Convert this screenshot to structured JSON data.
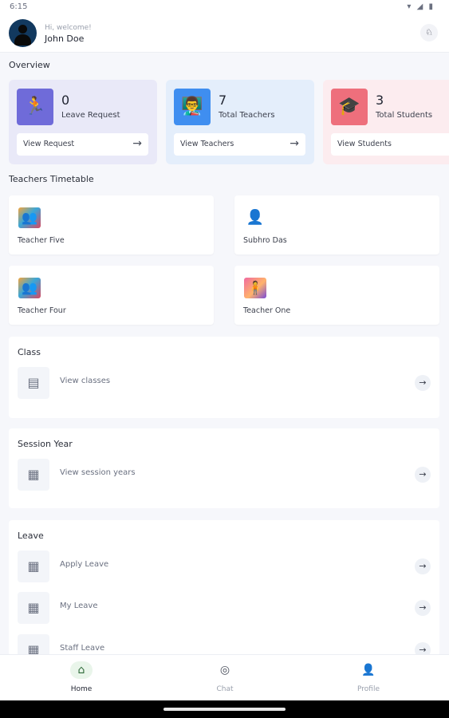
{
  "status_bar": {
    "time": "6:15"
  },
  "header": {
    "greeting": "Hi, welcome!",
    "user_name": "John Doe"
  },
  "overview": {
    "title": "Overview",
    "cards": [
      {
        "count": "0",
        "label": "Leave Request",
        "button": "View Request",
        "accent": "#6f6bd9",
        "bg": "#e9e9f8",
        "icon": "running-person-icon"
      },
      {
        "count": "7",
        "label": "Total Teachers",
        "button": "View Teachers",
        "accent": "#3f8ef0",
        "bg": "#e4eefb",
        "icon": "teacher-podium-icon"
      },
      {
        "count": "3",
        "label": "Total Students",
        "button": "View Students",
        "accent": "#ee6f7c",
        "bg": "#fcecef",
        "icon": "graduation-cap-icon"
      }
    ]
  },
  "timetable": {
    "title": "Teachers Timetable",
    "teachers": [
      {
        "name": "Teacher Five"
      },
      {
        "name": "Subhro Das"
      },
      {
        "name": "Teacher Four"
      },
      {
        "name": "Teacher One"
      }
    ]
  },
  "class_section": {
    "title": "Class",
    "items": [
      {
        "label": "View classes"
      }
    ]
  },
  "session_section": {
    "title": "Session Year",
    "items": [
      {
        "label": "View session years"
      }
    ]
  },
  "leave_section": {
    "title": "Leave",
    "items": [
      {
        "label": "Apply Leave"
      },
      {
        "label": "My Leave"
      },
      {
        "label": "Staff Leave"
      }
    ]
  },
  "bottom_nav": [
    {
      "label": "Home",
      "icon": "home-icon",
      "active": true
    },
    {
      "label": "Chat",
      "icon": "chat-icon",
      "active": false
    },
    {
      "label": "Profile",
      "icon": "profile-icon",
      "active": false
    }
  ]
}
